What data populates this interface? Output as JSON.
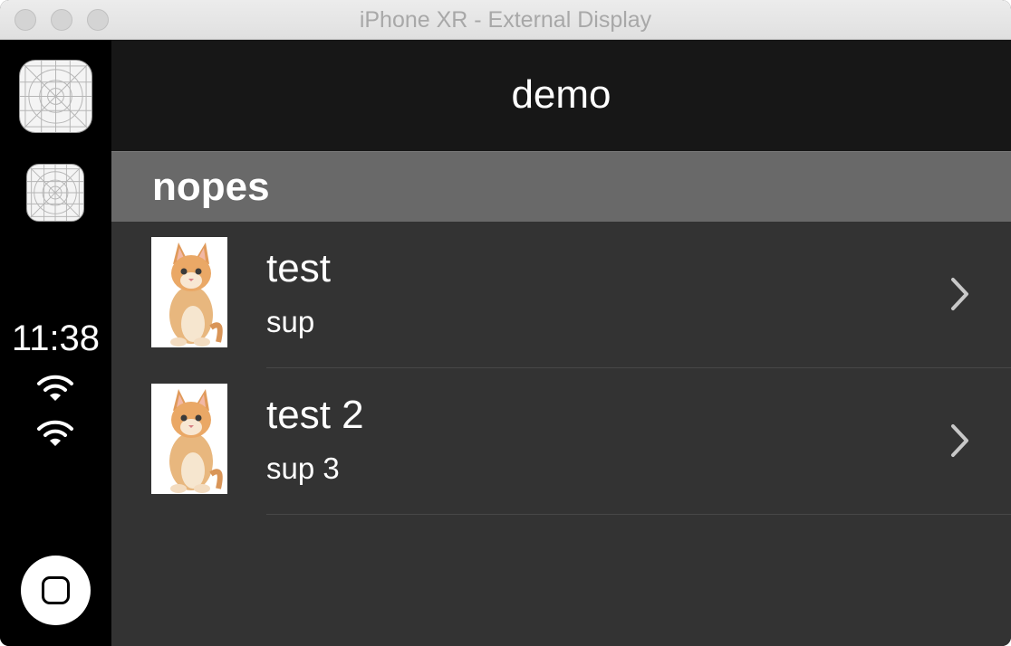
{
  "window": {
    "title": "iPhone XR - External Display"
  },
  "dock": {
    "apps": [
      {
        "icon": "app-placeholder-icon"
      },
      {
        "icon": "app-placeholder-icon"
      }
    ],
    "status": {
      "time": "11:38"
    }
  },
  "nav": {
    "title": "demo"
  },
  "list": {
    "section_title": "nopes",
    "rows": [
      {
        "title": "test",
        "subtitle": "sup",
        "image": "kitten-thumbnail"
      },
      {
        "title": "test 2",
        "subtitle": "sup 3",
        "image": "kitten-thumbnail"
      }
    ]
  },
  "colors": {
    "navbar": "#171717",
    "content_bg": "#333333",
    "section_header": "#696969",
    "dock": "#000000"
  }
}
